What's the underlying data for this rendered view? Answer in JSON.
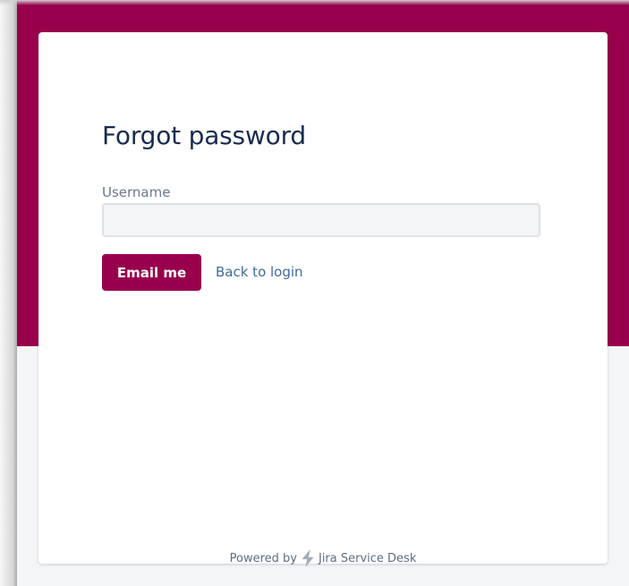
{
  "colors": {
    "brand": "#99004C",
    "page_bg": "#F4F5F7",
    "card_bg": "#FFFFFF",
    "title": "#172B4D",
    "label": "#6B778C",
    "link": "#3E6B9B"
  },
  "form": {
    "title": "Forgot password",
    "username_label": "Username",
    "username_value": "",
    "username_placeholder": "",
    "submit_label": "Email me",
    "back_link_label": "Back to login"
  },
  "footer": {
    "prefix": "Powered by",
    "product": "Jira Service Desk",
    "logo_icon": "jira-service-desk-icon"
  }
}
